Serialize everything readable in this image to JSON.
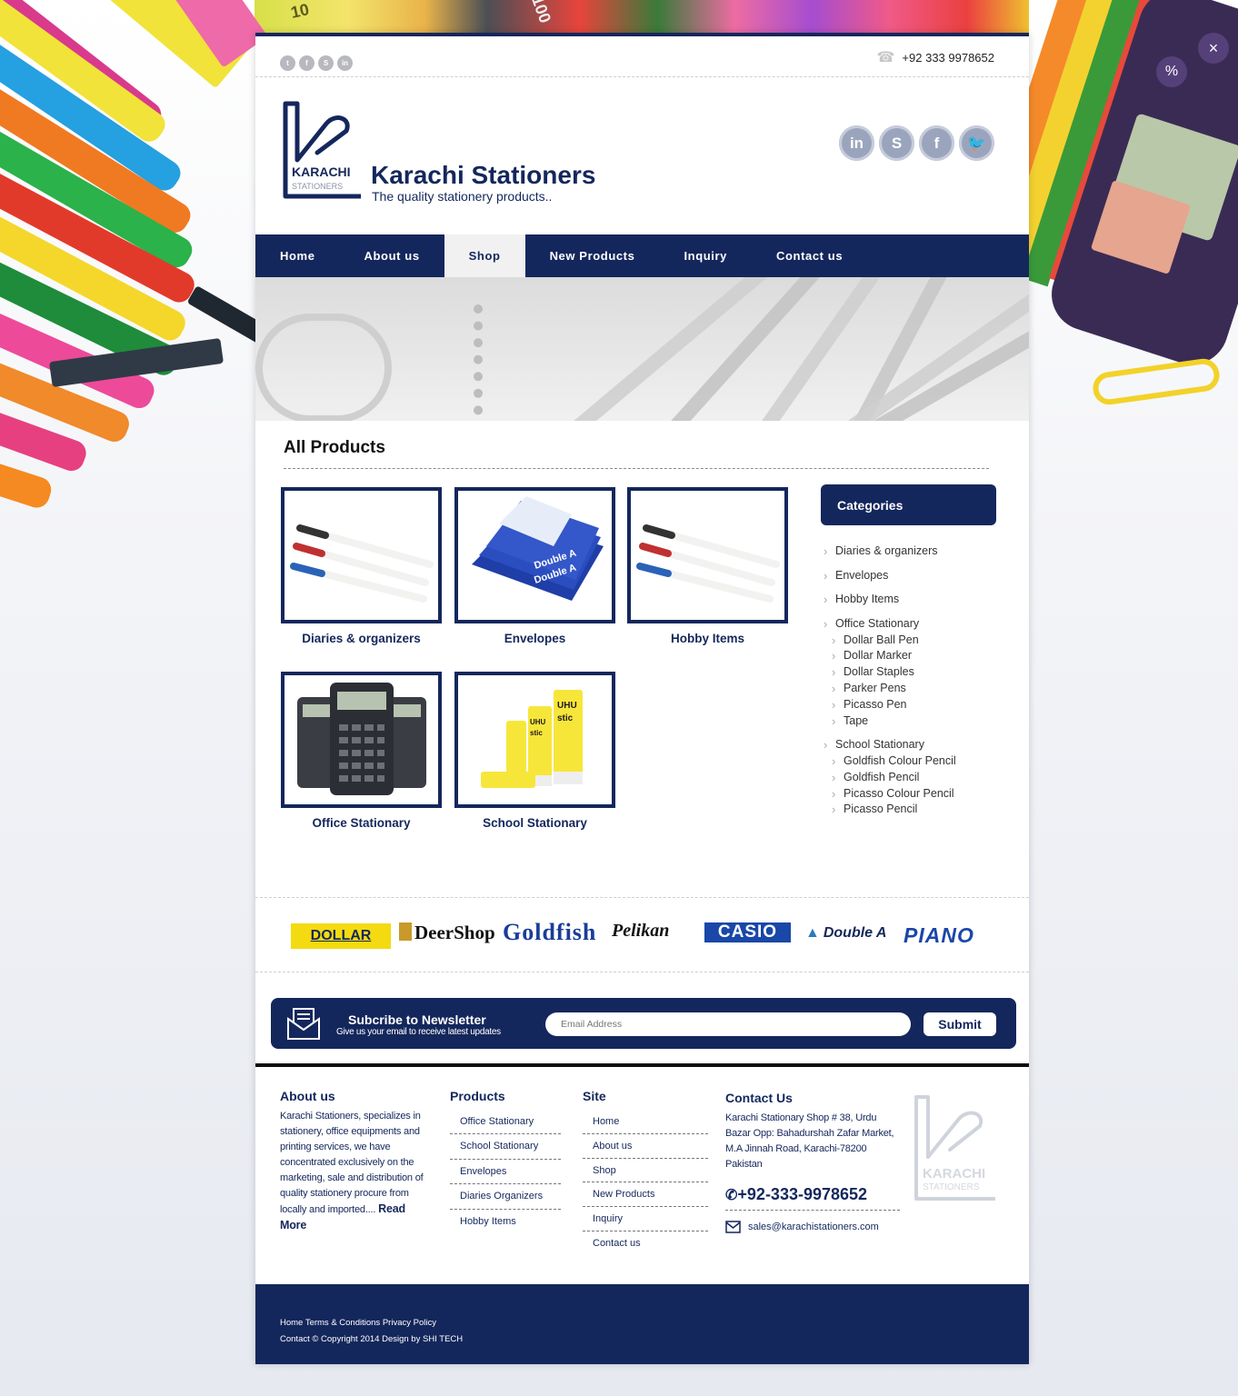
{
  "header": {
    "phone": "+92 333 9978652",
    "site_title": "Karachi Stationers",
    "tagline": "The quality stationery products..",
    "logo_text": "KARACHI",
    "logo_sub": "STATIONERS"
  },
  "nav": {
    "items": [
      {
        "label": "Home"
      },
      {
        "label": "About us"
      },
      {
        "label": "Shop"
      },
      {
        "label": "New Products"
      },
      {
        "label": "Inquiry"
      },
      {
        "label": "Contact us"
      }
    ],
    "active": "Shop"
  },
  "products": {
    "title": "All Products",
    "items": [
      {
        "label": "Diaries & organizers"
      },
      {
        "label": "Envelopes"
      },
      {
        "label": "Hobby Items"
      },
      {
        "label": "Office Stationary"
      },
      {
        "label": "School Stationary"
      }
    ]
  },
  "categories": {
    "title": "Categories",
    "items": [
      {
        "label": "Diaries & organizers",
        "level": 1
      },
      {
        "label": "Envelopes",
        "level": 1
      },
      {
        "label": "Hobby Items",
        "level": 1
      },
      {
        "label": "Office Stationary",
        "level": 1
      },
      {
        "label": "Dollar Ball Pen",
        "level": 2
      },
      {
        "label": "Dollar Marker",
        "level": 2
      },
      {
        "label": "Dollar Staples",
        "level": 2
      },
      {
        "label": "Parker Pens",
        "level": 2
      },
      {
        "label": "Picasso Pen",
        "level": 2
      },
      {
        "label": "Tape",
        "level": 2
      },
      {
        "label": "School Stationary",
        "level": 1
      },
      {
        "label": "Goldfish Colour Pencil",
        "level": 2
      },
      {
        "label": "Goldfish Pencil",
        "level": 2
      },
      {
        "label": "Picasso Colour Pencil",
        "level": 2
      },
      {
        "label": "Picasso Pencil",
        "level": 2
      }
    ]
  },
  "brands": [
    "DOLLAR",
    "DeerShop",
    "Goldfish",
    "Pelikan",
    "CASIO",
    "Double A",
    "PIANO"
  ],
  "newsletter": {
    "title": "Subcribe to Newsletter",
    "subtitle": "Give us your email to receive latest updates",
    "placeholder": "Email Address",
    "submit": "Submit"
  },
  "footer": {
    "about_title": "About us",
    "about_text": "Karachi Stationers, specializes in stationery, office equipments and printing services, we have concentrated exclusively on the marketing, sale and distribution of quality stationery procure from locally and imported.... ",
    "read_more": "Read More",
    "products_title": "Products",
    "products": [
      "Office Stationary",
      "School Stationary",
      "Envelopes",
      "Diaries Organizers",
      "Hobby Items"
    ],
    "site_title": "Site",
    "site_links": [
      "Home",
      "About us",
      "Shop",
      "New Products",
      "Inquiry",
      "Contact us"
    ],
    "contact_title": "Contact Us",
    "contact_address": "Karachi Stationary Shop # 38, Urdu Bazar Opp: Bahadurshah Zafar Market, M.A Jinnah Road, Karachi-78200 Pakistan",
    "contact_phone": "+92-333-9978652",
    "contact_email": "sales@karachistationers.com",
    "bottom_links": [
      "Home",
      "Terms & Conditions",
      "Privacy Policy"
    ],
    "bottom_contact": "Contact",
    "copyright": "© Copyright 2014 Design by SHI TECH"
  },
  "colors": {
    "navy": "#14275c",
    "nav_active_bg": "#f1f1f1"
  }
}
